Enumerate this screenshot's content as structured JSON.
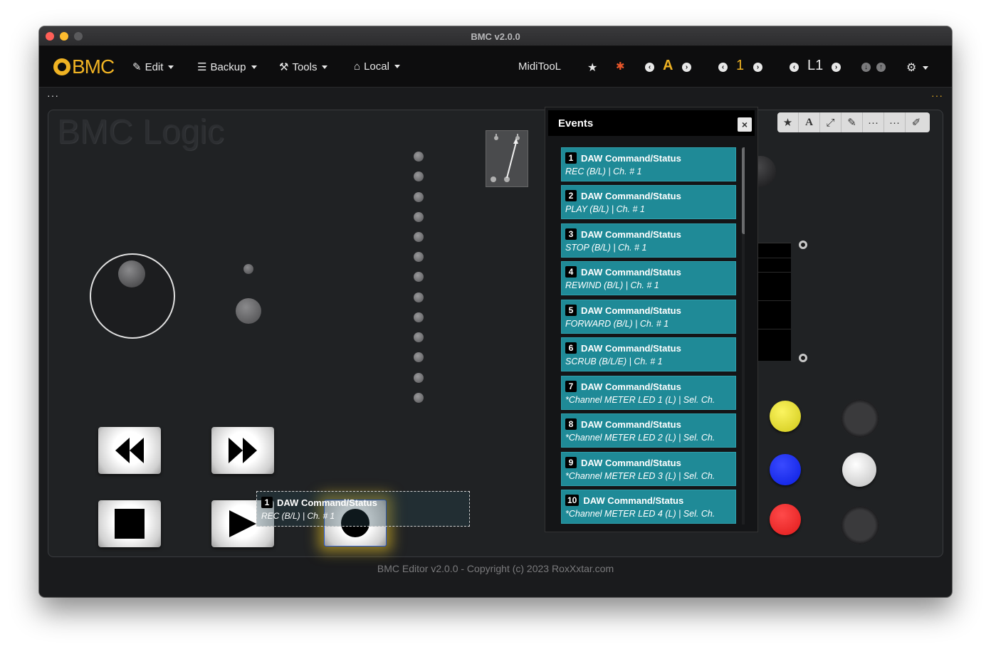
{
  "window": {
    "title": "BMC v2.0.0"
  },
  "navbar": {
    "logo": "BMC",
    "menus": [
      {
        "label": "Edit",
        "icon": "edit-icon"
      },
      {
        "label": "Backup",
        "icon": "database-icon"
      },
      {
        "label": "Tools",
        "icon": "wrench-icon"
      },
      {
        "label": "Local",
        "icon": "drive-icon"
      }
    ],
    "device_name": "MidiTooL",
    "preset_letter": "A",
    "bank_number": "1",
    "layer": "L1",
    "accent_color": "#f0b323"
  },
  "panel": {
    "title": "BMC Logic",
    "toolbar_icons": [
      "star-icon",
      "font-icon",
      "chart-icon",
      "plug-icon",
      "ellipsis-icon",
      "ellipsis-icon",
      "edit-icon"
    ]
  },
  "events_panel": {
    "title": "Events",
    "close_label": "×",
    "items": [
      {
        "num": "1",
        "title": "DAW Command/Status",
        "sub": "REC (B/L) | Ch. # 1"
      },
      {
        "num": "2",
        "title": "DAW Command/Status",
        "sub": "PLAY (B/L) | Ch. # 1"
      },
      {
        "num": "3",
        "title": "DAW Command/Status",
        "sub": "STOP (B/L) | Ch. # 1"
      },
      {
        "num": "4",
        "title": "DAW Command/Status",
        "sub": "REWIND (B/L) | Ch. # 1"
      },
      {
        "num": "5",
        "title": "DAW Command/Status",
        "sub": "FORWARD (B/L) | Ch. # 1"
      },
      {
        "num": "6",
        "title": "DAW Command/Status",
        "sub": "SCRUB (B/L/E) | Ch. # 1"
      },
      {
        "num": "7",
        "title": "DAW Command/Status",
        "sub": "*Channel METER LED 1 (L) | Sel. Ch."
      },
      {
        "num": "8",
        "title": "DAW Command/Status",
        "sub": "*Channel METER LED 2 (L) | Sel. Ch."
      },
      {
        "num": "9",
        "title": "DAW Command/Status",
        "sub": "*Channel METER LED 3 (L) | Sel. Ch."
      },
      {
        "num": "10",
        "title": "DAW Command/Status",
        "sub": "*Channel METER LED 4 (L) | Sel. Ch."
      }
    ]
  },
  "selected_event": {
    "num": "1",
    "title": "DAW Command/Status",
    "sub": "REC (B/L) | Ch. # 1"
  },
  "colors": {
    "yellow_led": "#e8e02a",
    "blue_led": "#0a1ee0",
    "red_led": "#e01a1a",
    "white_led": "#dcdcdc"
  },
  "footer": {
    "text": "BMC Editor v2.0.0 - Copyright (c) 2023 RoxXxtar.com"
  }
}
